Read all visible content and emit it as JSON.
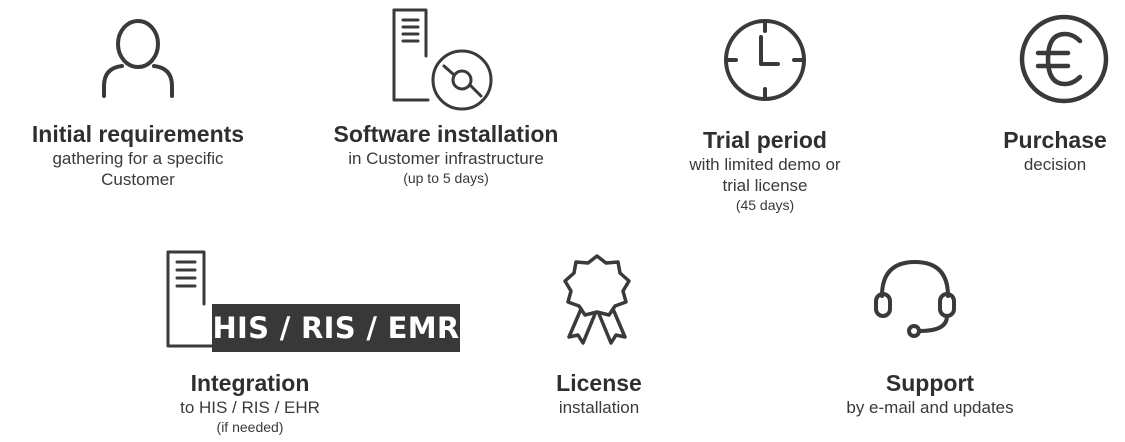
{
  "steps": [
    {
      "title": "Initial requirements",
      "line1": "gathering for a specific",
      "line2": "Customer",
      "icon": "user-icon"
    },
    {
      "title": "Software installation",
      "line1": "in Customer infrastructure",
      "note": "(up to 5 days)",
      "icon": "server-disc-icon"
    },
    {
      "title": "Trial period",
      "line1": "with limited demo or",
      "line2": "trial license",
      "note": "(45 days)",
      "icon": "clock-icon"
    },
    {
      "title": "Purchase",
      "line1": "decision",
      "icon": "euro-icon"
    },
    {
      "title": "Integration",
      "line1": "to HIS / RIS / EHR",
      "note": "(if needed)",
      "icon": "server-icon",
      "badge": "HIS / RIS / EMR"
    },
    {
      "title": "License",
      "line1": "installation",
      "icon": "award-ribbon-icon"
    },
    {
      "title": "Support",
      "line1": "by e-mail and updates",
      "icon": "headset-icon"
    }
  ],
  "colors": {
    "stroke": "#3a3a3a",
    "badge_bg": "#383838",
    "badge_text": "#ffffff"
  }
}
